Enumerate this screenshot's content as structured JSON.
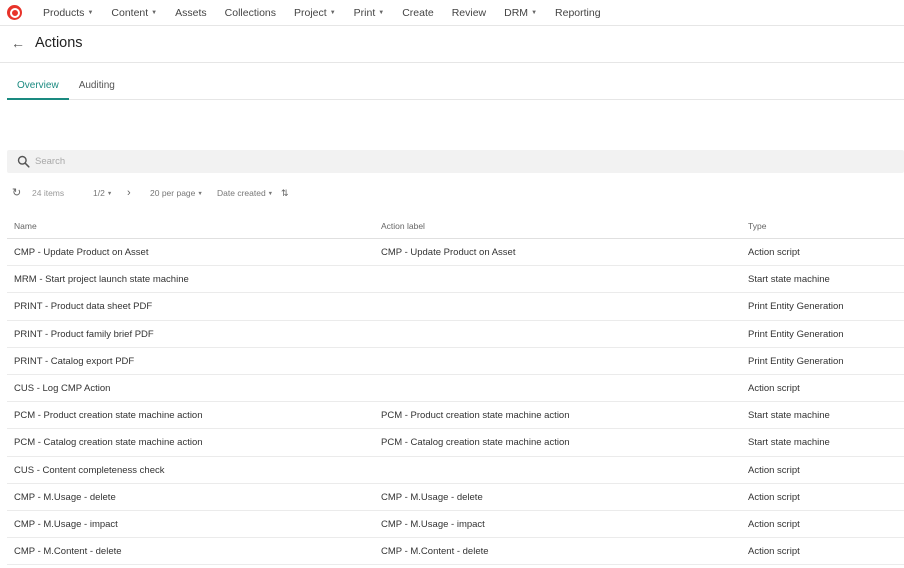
{
  "nav": {
    "items": [
      {
        "label": "Products",
        "dropdown": true
      },
      {
        "label": "Content",
        "dropdown": true
      },
      {
        "label": "Assets",
        "dropdown": false
      },
      {
        "label": "Collections",
        "dropdown": false
      },
      {
        "label": "Project",
        "dropdown": true
      },
      {
        "label": "Print",
        "dropdown": true
      },
      {
        "label": "Create",
        "dropdown": false
      },
      {
        "label": "Review",
        "dropdown": false
      },
      {
        "label": "DRM",
        "dropdown": true
      },
      {
        "label": "Reporting",
        "dropdown": false
      }
    ],
    "logo_color": "#e8332a"
  },
  "page": {
    "title": "Actions"
  },
  "tabs": [
    {
      "label": "Overview",
      "active": true
    },
    {
      "label": "Auditing",
      "active": false
    }
  ],
  "search": {
    "placeholder": "Search",
    "value": ""
  },
  "toolbar": {
    "items_count": "24 items",
    "page": "1/2",
    "per_page": "20 per page",
    "sort_by": "Date created"
  },
  "table": {
    "headers": {
      "name": "Name",
      "label": "Action label",
      "type": "Type"
    },
    "rows": [
      {
        "name": "CMP - Update Product on Asset",
        "label": "CMP - Update Product on Asset",
        "type": "Action script"
      },
      {
        "name": "MRM - Start project launch state machine",
        "label": "",
        "type": "Start state machine"
      },
      {
        "name": "PRINT - Product data sheet PDF",
        "label": "",
        "type": "Print Entity Generation"
      },
      {
        "name": "PRINT - Product family brief PDF",
        "label": "",
        "type": "Print Entity Generation"
      },
      {
        "name": "PRINT - Catalog export PDF",
        "label": "",
        "type": "Print Entity Generation"
      },
      {
        "name": "CUS - Log CMP Action",
        "label": "",
        "type": "Action script"
      },
      {
        "name": "PCM - Product creation state machine action",
        "label": "PCM - Product creation state machine action",
        "type": "Start state machine"
      },
      {
        "name": "PCM - Catalog creation state machine action",
        "label": "PCM - Catalog creation state machine action",
        "type": "Start state machine"
      },
      {
        "name": "CUS - Content completeness check",
        "label": "",
        "type": "Action script"
      },
      {
        "name": "CMP - M.Usage - delete",
        "label": "CMP - M.Usage - delete",
        "type": "Action script"
      },
      {
        "name": "CMP - M.Usage - impact",
        "label": "CMP - M.Usage - impact",
        "type": "Action script"
      },
      {
        "name": "CMP - M.Content - delete",
        "label": "CMP - M.Content - delete",
        "type": "Action script"
      }
    ]
  },
  "colors": {
    "accent": "#1a8a80"
  }
}
